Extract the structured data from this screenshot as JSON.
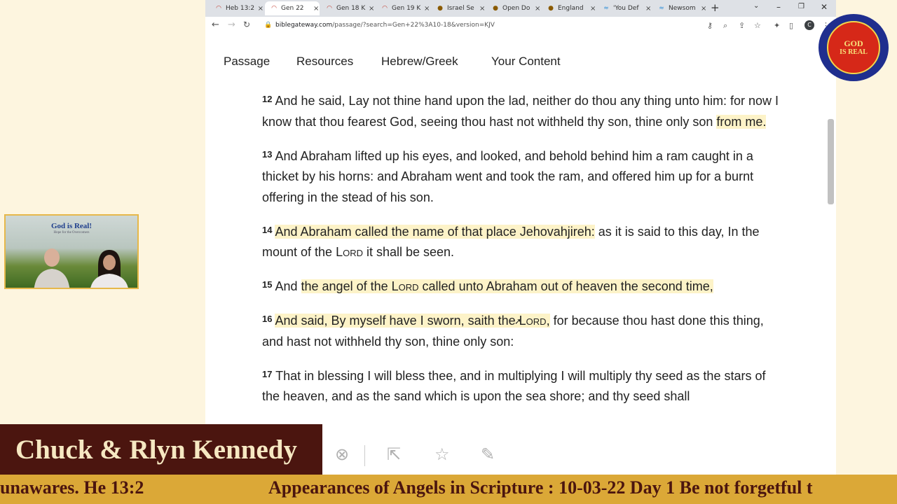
{
  "browser": {
    "tabs": [
      {
        "label": "Heb 13:2",
        "icon": "bible-gateway-icon",
        "active": false
      },
      {
        "label": "Gen 22",
        "icon": "bible-gateway-icon",
        "active": true
      },
      {
        "label": "Gen 18 K",
        "icon": "bible-gateway-icon",
        "active": false
      },
      {
        "label": "Gen 19 K",
        "icon": "bible-gateway-icon",
        "active": false
      },
      {
        "label": "Israel Se",
        "icon": "site-icon",
        "active": false
      },
      {
        "label": "Open Do",
        "icon": "site-icon",
        "active": false
      },
      {
        "label": "England",
        "icon": "site-icon",
        "active": false
      },
      {
        "label": "'You Def",
        "icon": "site-icon",
        "active": false
      },
      {
        "label": "Newsom",
        "icon": "site-icon",
        "active": false
      }
    ],
    "tab_close": "×",
    "new_tab": "+",
    "url_host": "biblegateway.com",
    "url_path": "/passage/?search=Gen+22%3A10-18&version=KJV",
    "profile_initial": "C"
  },
  "site_nav": {
    "items": [
      "Passage",
      "Resources",
      "Hebrew/Greek",
      "Your Content"
    ]
  },
  "verses": {
    "v12": {
      "num": "12",
      "text": "And he said, Lay not thine hand upon the lad, neither do thou any thing unto him: for now I know that thou fearest God, seeing thou hast not withheld thy son, thine only son ",
      "hl": "from me."
    },
    "v13": {
      "num": "13",
      "text": "And Abraham lifted up his eyes, and looked, and behold behind him a ram caught in a thicket by his horns: and Abraham went and took the ram, and offered him up for a burnt offering in the stead of his son."
    },
    "v14": {
      "num": "14",
      "hl": "And Abraham called the name of that place Jehovahjireh:",
      "a": " as it is said to this day, In the mount of the ",
      "lord": "Lord",
      "b": " it shall be seen."
    },
    "v15": {
      "num": "15",
      "a": "And ",
      "hl_a": "the angel of the ",
      "lord": "Lord",
      "hl_b": " called unto Abraham out of heaven the second time,"
    },
    "v16": {
      "num": "16",
      "hl_a": "And said, By myself have I sworn, saith the ",
      "lord": "Lord",
      "hl_b": ",",
      "b": " for because thou hast done this thing, and hast not withheld thy son, thine only son:"
    },
    "v17": {
      "num": "17",
      "text": "That in blessing I will bless thee, and in multiplying I will multiply thy seed as the stars of the heaven, and as the sand which is upon the sea shore; and thy seed shall"
    }
  },
  "video": {
    "title": "God is Real!",
    "subtitle": "Hope for the Overcomers"
  },
  "logo": {
    "line1": "GOD",
    "line2": "IS REAL"
  },
  "overlay": {
    "name": "Chuck & Rlyn Kennedy",
    "ticker_a": "unawares. He 13:2",
    "ticker_b": "Appearances of Angels in Scripture : 10-03-22 Day 1 Be not forgetful t"
  },
  "colors": {
    "highlight": "#fdf3c8",
    "namebar": "#4b150f",
    "ticker": "#dba837",
    "frame": "#e6b84a"
  }
}
